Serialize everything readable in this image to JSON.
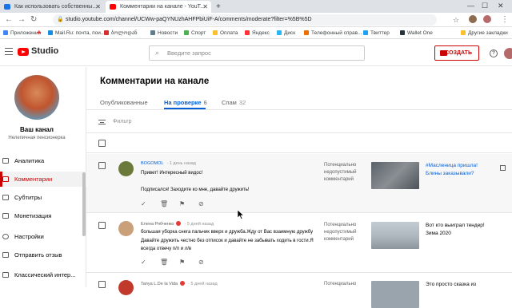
{
  "browser": {
    "tabs": [
      {
        "title": "Как использовать собственны...",
        "active": false
      },
      {
        "title": "Комментарии на канале - YouT...",
        "active": true
      }
    ],
    "new_tab": "+",
    "address": "studio.youtube.com/channel/UCWw-paQYNUzhAHFPbiUiF-A/comments/moderate?filter=%5B%5D",
    "bookmarks": [
      "Приложения",
      "",
      "Mail.Ru: почта, пои...",
      "ბოლოდან",
      "Новости",
      "Спорт",
      "Оплата",
      "Яндекс",
      "Диск",
      "Телефонный справ...",
      "Твиттер",
      "Wallet One",
      "Другие закладки"
    ]
  },
  "header": {
    "logo_text": "Studio",
    "search_placeholder": "Введите запрос",
    "create_label": "СОЗДАТЬ",
    "help_label": "?"
  },
  "sidebar": {
    "channel_name": "Ваш канал",
    "channel_sub": "Нелепичная пенсионерка",
    "items": [
      {
        "label": "Аналитика",
        "icon": "analytics-icon",
        "active": false
      },
      {
        "label": "Комментарии",
        "icon": "comments-icon",
        "active": true
      },
      {
        "label": "Субтитры",
        "icon": "subtitles-icon",
        "active": false
      },
      {
        "label": "Монетизация",
        "icon": "monetization-icon",
        "active": false
      },
      {
        "label": "Настройки",
        "icon": "gear-icon",
        "active": false
      },
      {
        "label": "Отправить отзыв",
        "icon": "feedback-icon",
        "active": false
      },
      {
        "label": "Классический интер...",
        "icon": "classic-icon",
        "active": false
      }
    ]
  },
  "main": {
    "title": "Комментарии на канале",
    "tabs": [
      {
        "label": "Опубликованные",
        "count": ""
      },
      {
        "label": "На проверке",
        "count": "6"
      },
      {
        "label": "Спам",
        "count": "32"
      }
    ],
    "filter_placeholder": "Фильтр",
    "comments": [
      {
        "author": "BOGOMOL",
        "time": "· 1 день назад",
        "text": "Привет! Интересный видос!\n\nПодписался! Заходите ко мне, давайте дружить!",
        "status": "Потенциально недопустимый комментарий",
        "video_title": "#Масленица пришла! Блины заказывали?",
        "avatar_color": "#6b7a3a",
        "thumb_color": "#6a6f74"
      },
      {
        "author": "Елена Рябченко",
        "time": "· 5 дней назад",
        "text": "большая уборка снега пальчик вверх и дружба.Жду от Вас взаимную дружбу Давайте дружить честно без отписок и давайте не забывать ходить в гости.Я всегда отвечу п/п и л/в",
        "status": "Потенциально недопустимый комментарий",
        "video_title": "Вот кто выиграл тендер! Зима 2020",
        "avatar_color": "#c9a07a",
        "thumb_color": "#aeb6bd"
      },
      {
        "author": "Tanya L.De la Vida",
        "time": "· 5 дней назад",
        "text": "",
        "status": "Потенциально",
        "video_title": "Это просто сказка из",
        "avatar_color": "#c0392b",
        "thumb_color": "#9aa4ac"
      }
    ]
  },
  "colors": {
    "accent_red": "#cc0000",
    "link_blue": "#065fd4"
  }
}
